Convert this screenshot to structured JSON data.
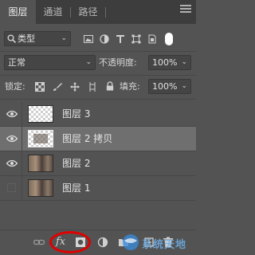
{
  "tabs": [
    {
      "label": "图层",
      "active": true
    },
    {
      "label": "通道",
      "active": false
    },
    {
      "label": "路径",
      "active": false
    }
  ],
  "filter": {
    "kind_label": "类型"
  },
  "blend": {
    "mode": "正常",
    "opacity_label": "不透明度:",
    "opacity_value": "100%"
  },
  "lock": {
    "label": "锁定:",
    "fill_label": "填充:",
    "fill_value": "100%"
  },
  "layers": [
    {
      "name": "图层 3",
      "visible": true,
      "selected": false,
      "thumb": "checker"
    },
    {
      "name": "图层 2 拷贝",
      "visible": true,
      "selected": true,
      "thumb": "checker-outlined"
    },
    {
      "name": "图层 2",
      "visible": true,
      "selected": false,
      "thumb": "photo"
    },
    {
      "name": "图层 1",
      "visible": false,
      "selected": false,
      "thumb": "photo"
    }
  ],
  "bottom": {
    "fx_label": "fx"
  },
  "watermark": {
    "text": "系统天地"
  },
  "colors": {
    "panel": "#535353",
    "tabbar": "#3d3d3d",
    "selected_row": "#6f6f6f",
    "highlight": "#e00000"
  }
}
